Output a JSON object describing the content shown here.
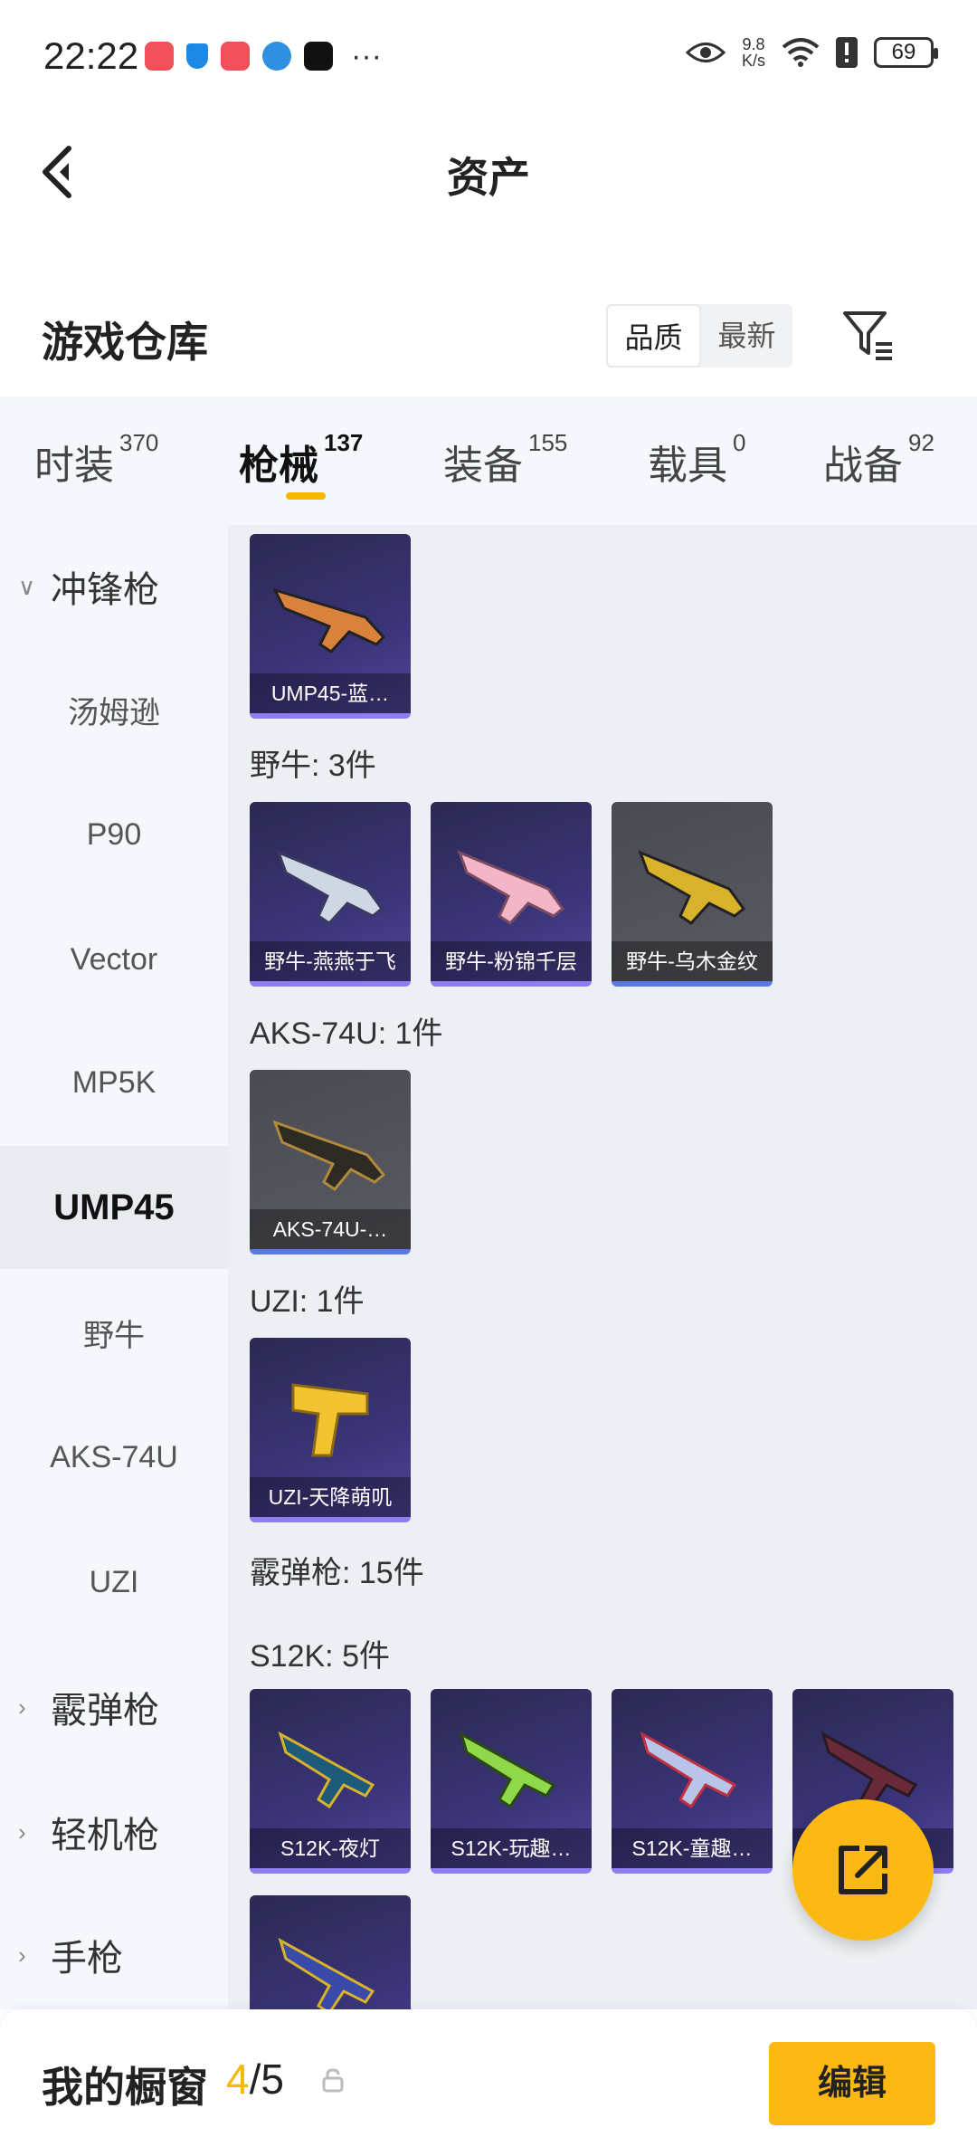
{
  "status_bar": {
    "time": "22:22",
    "net_speed_top": "9.8",
    "net_speed_bottom": "K/s",
    "battery": "69",
    "more": "···"
  },
  "header": {
    "title": "资产"
  },
  "warehouse": {
    "title": "游戏仓库",
    "sort_options": [
      "品质",
      "最新"
    ],
    "selected_sort": "品质"
  },
  "tabs": [
    {
      "label": "时装",
      "count": "370"
    },
    {
      "label": "枪械",
      "count": "137"
    },
    {
      "label": "装备",
      "count": "155"
    },
    {
      "label": "载具",
      "count": "0"
    },
    {
      "label": "战备",
      "count": "92"
    }
  ],
  "sidebar": {
    "items": [
      {
        "label": "冲锋枪",
        "type": "group",
        "chevron": "∨"
      },
      {
        "label": "汤姆逊",
        "type": "sub"
      },
      {
        "label": "P90",
        "type": "sub"
      },
      {
        "label": "Vector",
        "type": "sub"
      },
      {
        "label": "MP5K",
        "type": "sub"
      },
      {
        "label": "UMP45",
        "type": "sub",
        "selected": true
      },
      {
        "label": "野牛",
        "type": "sub"
      },
      {
        "label": "AKS-74U",
        "type": "sub"
      },
      {
        "label": "UZI",
        "type": "sub"
      },
      {
        "label": "霰弹枪",
        "type": "group",
        "chevron": "›"
      },
      {
        "label": "轻机枪",
        "type": "group",
        "chevron": "›"
      },
      {
        "label": "手枪",
        "type": "group",
        "chevron": "›"
      }
    ]
  },
  "content": {
    "group_labels": [
      "野牛: 3件",
      "AKS-74U: 1件",
      "UZI: 1件",
      "霰弹枪: 15件",
      "S12K: 5件"
    ],
    "cards": [
      {
        "label": "UMP45-蓝…",
        "rarity": "purple"
      },
      {
        "label": "野牛-燕燕于飞",
        "rarity": "purple"
      },
      {
        "label": "野牛-粉锦千层",
        "rarity": "purple"
      },
      {
        "label": "野牛-乌木金纹",
        "rarity": "grey"
      },
      {
        "label": "AKS-74U-…",
        "rarity": "grey"
      },
      {
        "label": "UZI-天降萌叽",
        "rarity": "purple"
      },
      {
        "label": "S12K-夜灯",
        "rarity": "purple"
      },
      {
        "label": "S12K-玩趣…",
        "rarity": "purple"
      },
      {
        "label": "S12K-童趣…",
        "rarity": "purple"
      },
      {
        "label": "",
        "rarity": "purple"
      },
      {
        "label": "",
        "rarity": "purple"
      }
    ]
  },
  "bottom_bar": {
    "title": "我的橱窗",
    "count_current": "4",
    "count_total": "/5",
    "edit_label": "编辑"
  },
  "colors": {
    "accent": "#fdb913",
    "tab_underline": "#f5b800",
    "sidebar_bg": "#f4f7fb",
    "content_bg": "#eceff3"
  },
  "icons": [
    "back-arrow-icon",
    "filter-icon",
    "lock-icon",
    "share-icon",
    "eye-icon",
    "wifi-icon",
    "alert-icon",
    "battery-icon"
  ]
}
